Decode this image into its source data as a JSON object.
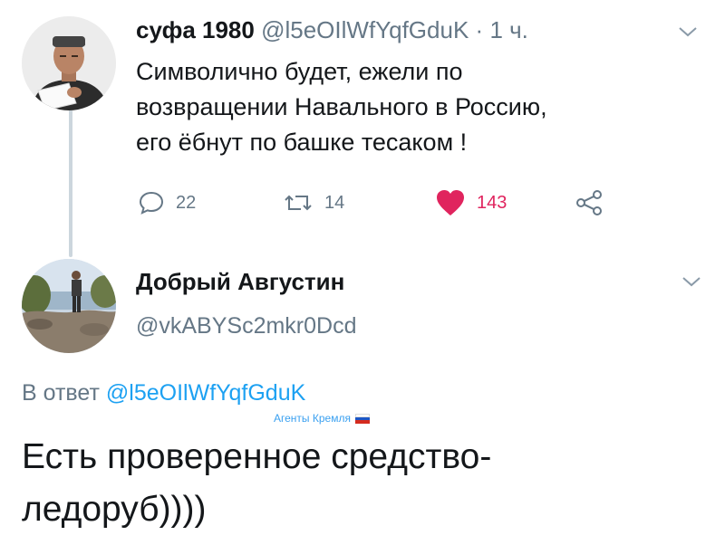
{
  "colors": {
    "text": "#14171a",
    "muted": "#657786",
    "link": "#1da1f2",
    "like": "#e0245e",
    "thread_line": "#ccd6dd"
  },
  "tweet1": {
    "name": "суфа 1980",
    "handle": "@l5eOIlWfYqfGduK",
    "separator": "·",
    "time": "1 ч.",
    "text_lines": [
      "Символично будет, ежели по",
      "возвращении Навального в Россию,",
      "его ёбнут по башке тесаком !"
    ],
    "actions": {
      "reply_icon": "reply-icon",
      "reply_count": "22",
      "retweet_icon": "retweet-icon",
      "retweet_count": "14",
      "like_icon": "heart-icon",
      "like_count": "143",
      "share_icon": "share-icon"
    },
    "menu_icon": "chevron-down-icon"
  },
  "tweet2": {
    "name": "Добрый Августин",
    "handle": "@vkABYSc2mkr0Dcd",
    "menu_icon": "chevron-down-icon",
    "reply_prefix": "В ответ",
    "reply_mention": "@l5eOIlWfYqfGduK",
    "text_lines": [
      "Есть проверенное средство-",
      "ледоруб))))"
    ]
  },
  "watermark": {
    "text": "Агенты Кремля",
    "flag_icon": "russian-flag-icon"
  }
}
